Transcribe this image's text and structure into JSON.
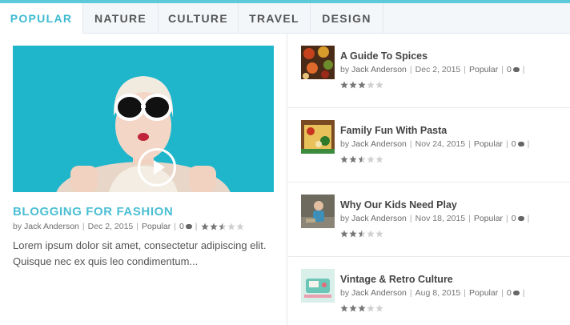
{
  "tabs": [
    {
      "label": "POPULAR",
      "active": true
    },
    {
      "label": "NATURE",
      "active": false
    },
    {
      "label": "CULTURE",
      "active": false
    },
    {
      "label": "TRAVEL",
      "active": false
    },
    {
      "label": "DESIGN",
      "active": false
    }
  ],
  "featured": {
    "title": "BLOGGING FOR FASHION",
    "by": "by",
    "author": "Jack Anderson",
    "date": "Dec 2, 2015",
    "category": "Popular",
    "comments": "0",
    "rating": 2.5,
    "excerpt": "Lorem ipsum dolor sit amet, consectetur adipiscing elit. Quisque nec ex quis leo condimentum..."
  },
  "posts": [
    {
      "title": "A Guide To Spices",
      "by": "by",
      "author": "Jack Anderson",
      "date": "Dec 2, 2015",
      "category": "Popular",
      "comments": "0",
      "rating": 3
    },
    {
      "title": "Family Fun With Pasta",
      "by": "by",
      "author": "Jack Anderson",
      "date": "Nov 24, 2015",
      "category": "Popular",
      "comments": "0",
      "rating": 2.5
    },
    {
      "title": "Why Our Kids Need Play",
      "by": "by",
      "author": "Jack Anderson",
      "date": "Nov 18, 2015",
      "category": "Popular",
      "comments": "0",
      "rating": 2.5
    },
    {
      "title": "Vintage & Retro Culture",
      "by": "by",
      "author": "Jack Anderson",
      "date": "Aug 8, 2015",
      "category": "Popular",
      "comments": "0",
      "rating": 3
    }
  ],
  "colors": {
    "accent": "#4bbfd3",
    "topbar": "#5ccad8",
    "star_on": "#777777",
    "star_off": "#d0d0d0"
  },
  "icons": {
    "play": "play-icon",
    "comment": "comment-icon",
    "star": "star-icon"
  }
}
